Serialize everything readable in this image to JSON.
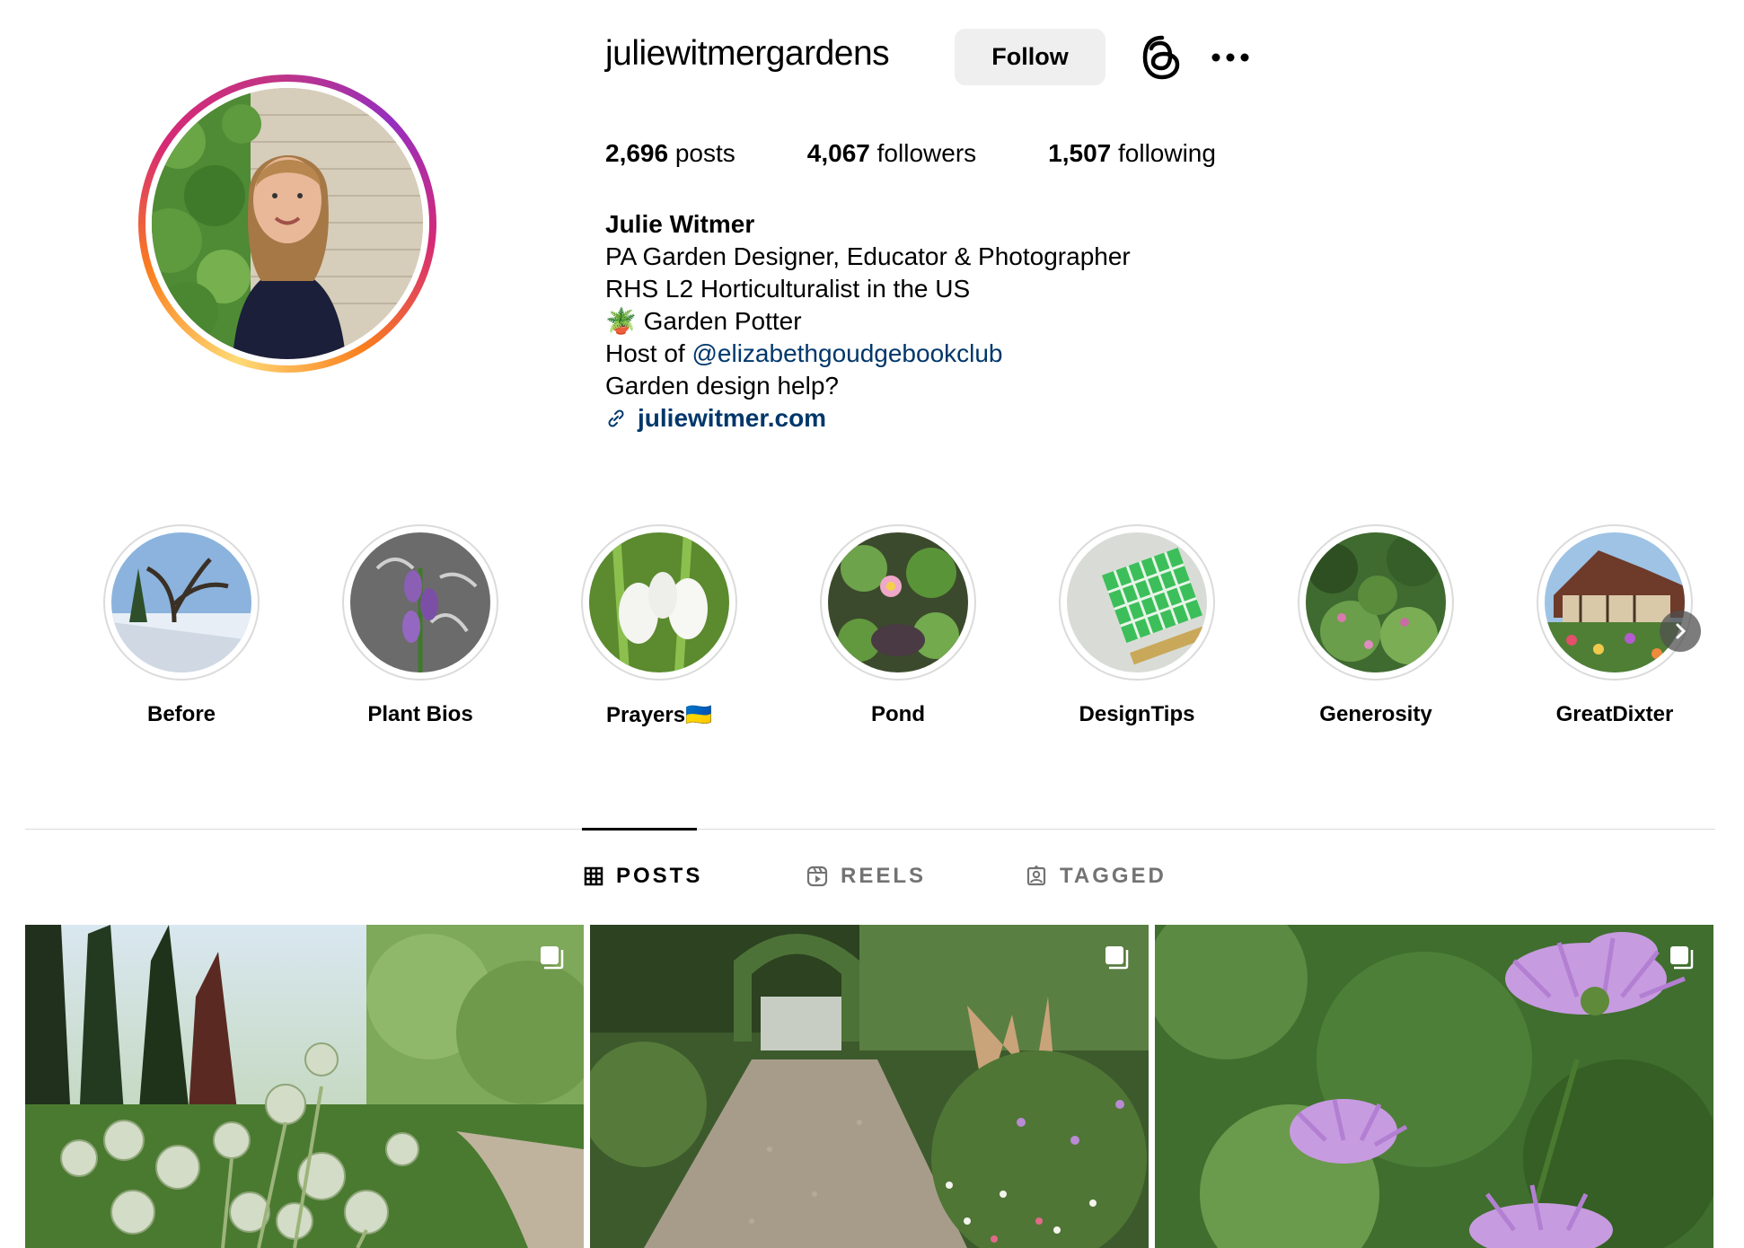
{
  "profile": {
    "username": "juliewitmergardens",
    "follow_label": "Follow",
    "stats": {
      "posts_count": "2,696",
      "posts_label": "posts",
      "followers_count": "4,067",
      "followers_label": "followers",
      "following_count": "1,507",
      "following_label": "following"
    },
    "bio": {
      "name": "Julie Witmer",
      "line1": "PA Garden Designer, Educator & Photographer",
      "line2": "RHS L2 Horticulturalist in the US",
      "line3_emoji": "🪴",
      "line3": "Garden Potter",
      "line4_prefix": "Host of ",
      "line4_mention": "@elizabethgoudgebookclub",
      "line5": "Garden design help?",
      "link": "juliewitmer.com"
    }
  },
  "highlights": [
    {
      "label": "Before"
    },
    {
      "label": "Plant Bios"
    },
    {
      "label": "Prayers🇺🇦"
    },
    {
      "label": "Pond"
    },
    {
      "label": "DesignTips"
    },
    {
      "label": "Generosity"
    },
    {
      "label": "GreatDixter"
    }
  ],
  "tabs": {
    "posts": "POSTS",
    "reels": "REELS",
    "tagged": "TAGGED"
  },
  "icons": {
    "threads": "threads-icon",
    "more": "more-options-icon",
    "link": "link-icon",
    "grid": "grid-icon",
    "reels": "reels-icon",
    "tagged": "tagged-icon",
    "multi": "carousel-icon"
  },
  "colors": {
    "link": "#00376b",
    "follow_bg": "#efefef",
    "inactive_tab": "#737373"
  }
}
